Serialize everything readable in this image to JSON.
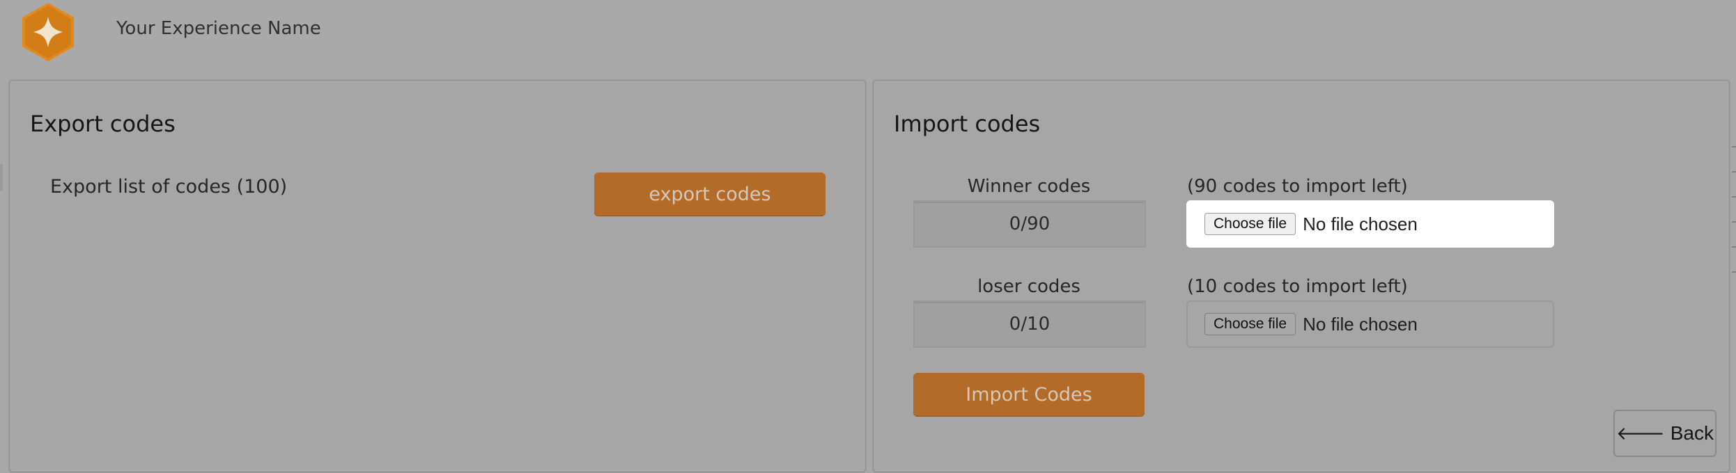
{
  "header": {
    "app_title": "Your Experience Name",
    "logo_icon": "star-hexagon-logo-icon"
  },
  "export": {
    "title": "Export codes",
    "description": "Export list of codes (100)",
    "button_label": "export codes"
  },
  "import": {
    "title": "Import codes",
    "winner": {
      "label": "Winner codes",
      "count": "0/90",
      "help": "(90 codes to import left)",
      "choose_label": "Choose file",
      "status": "No file chosen"
    },
    "loser": {
      "label": "loser codes",
      "count": "0/10",
      "help": "(10 codes to import left)",
      "choose_label": "Choose file",
      "status": "No file chosen"
    },
    "button_label": "Import Codes"
  },
  "back": {
    "label": "Back",
    "icon": "arrow-left-icon"
  },
  "colors": {
    "accent": "#b36b2a",
    "overlay": "#a8a8a8",
    "logo": "#e08a1e"
  }
}
